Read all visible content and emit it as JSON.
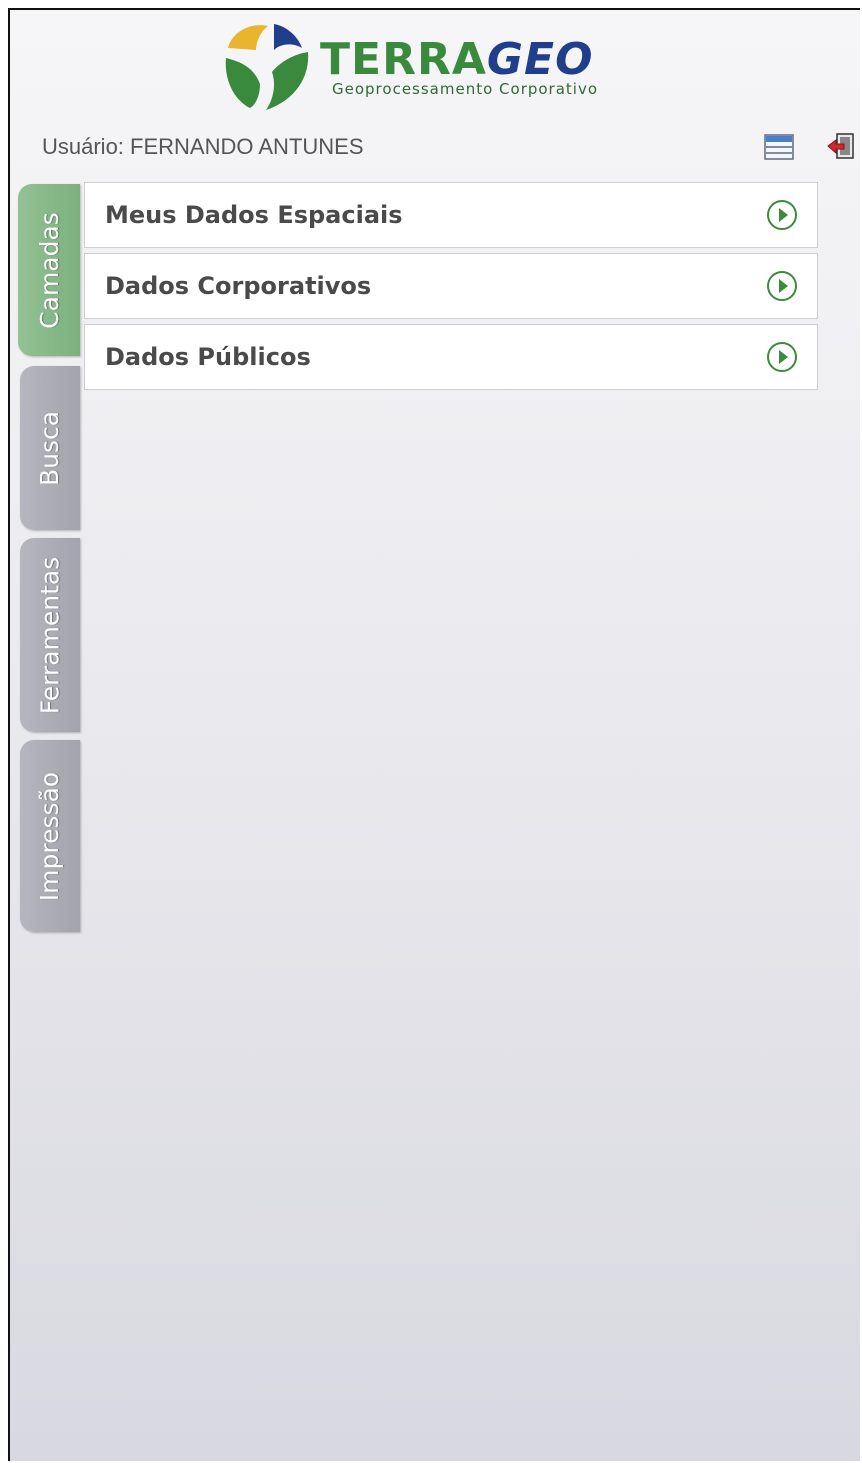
{
  "header": {
    "logo_terra": "TERRA",
    "logo_geo": "GEO",
    "logo_subtitle": "Geoprocessamento Corporativo",
    "user_label": "Usuário: FERNANDO ANTUNES",
    "icons": [
      "panel-toggle-icon",
      "logout-icon"
    ]
  },
  "tabs": [
    {
      "label": "Camadas",
      "active": true
    },
    {
      "label": "Busca",
      "active": false
    },
    {
      "label": "Ferramentas",
      "active": false
    },
    {
      "label": "Impressão",
      "active": false
    }
  ],
  "list": {
    "items": [
      {
        "label": "Meus Dados Espaciais",
        "icon": "play-circle-icon"
      },
      {
        "label": "Dados Corporativos",
        "icon": "play-circle-icon"
      },
      {
        "label": "Dados Públicos",
        "icon": "play-circle-icon"
      }
    ]
  },
  "colors": {
    "accent_green": "#3a8a3e",
    "brand_blue": "#1f3f8c",
    "active_tab": "#8bbd8c",
    "inactive_tab": "#adadb5"
  }
}
